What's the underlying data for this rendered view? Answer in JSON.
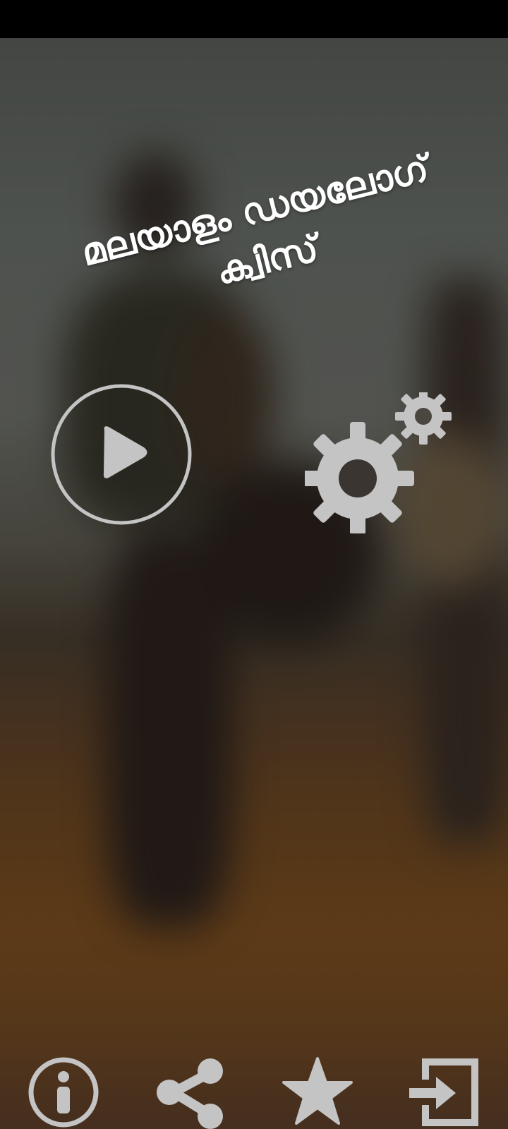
{
  "app": {
    "title_line1": "മലയാളം ഡയലോഗ്",
    "title_line2": "ക്വിസ്"
  },
  "main": {
    "play_button": {
      "icon": "play-circle-icon"
    },
    "settings_button": {
      "icon": "gears-icon"
    }
  },
  "bottom_bar": {
    "items": [
      {
        "icon": "info-icon"
      },
      {
        "icon": "share-icon"
      },
      {
        "icon": "star-icon"
      },
      {
        "icon": "exit-icon"
      }
    ]
  },
  "colors": {
    "icon": "#c4c4c4",
    "title_text": "#ffffff",
    "status_bar": "#000000"
  }
}
